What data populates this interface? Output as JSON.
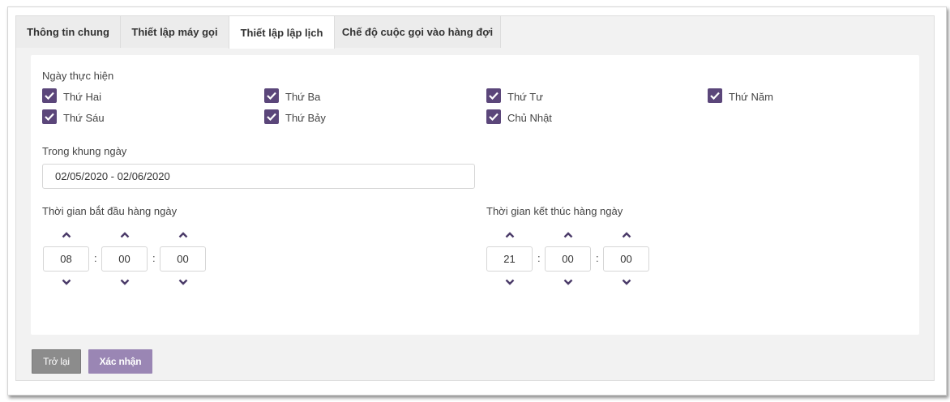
{
  "tabs": [
    {
      "label": "Thông tin chung",
      "active": false
    },
    {
      "label": "Thiết lập máy gọi",
      "active": false
    },
    {
      "label": "Thiết lập lập lịch",
      "active": true
    },
    {
      "label": "Chế độ cuộc gọi vào hàng đợi",
      "active": false
    }
  ],
  "days": {
    "label": "Ngày thực hiện",
    "items": [
      {
        "label": "Thứ Hai",
        "checked": true
      },
      {
        "label": "Thứ Ba",
        "checked": true
      },
      {
        "label": "Thứ Tư",
        "checked": true
      },
      {
        "label": "Thứ Năm",
        "checked": true
      },
      {
        "label": "Thứ Sáu",
        "checked": true
      },
      {
        "label": "Thứ Bảy",
        "checked": true
      },
      {
        "label": "Chủ Nhật",
        "checked": true
      }
    ]
  },
  "date_range": {
    "label": "Trong khung ngày",
    "value": "02/05/2020 - 02/06/2020"
  },
  "start_time": {
    "label": "Thời gian bắt đầu hàng ngày",
    "hour": "08",
    "minute": "00",
    "second": "00"
  },
  "end_time": {
    "label": "Thời gian kết thúc hàng ngày",
    "hour": "21",
    "minute": "00",
    "second": "00"
  },
  "separator": ":",
  "buttons": {
    "back": "Trở lại",
    "confirm": "Xác nhận"
  },
  "colors": {
    "accent": "#5b467a",
    "confirm_button": "#9a86b4",
    "back_button": "#8c8c8c"
  }
}
